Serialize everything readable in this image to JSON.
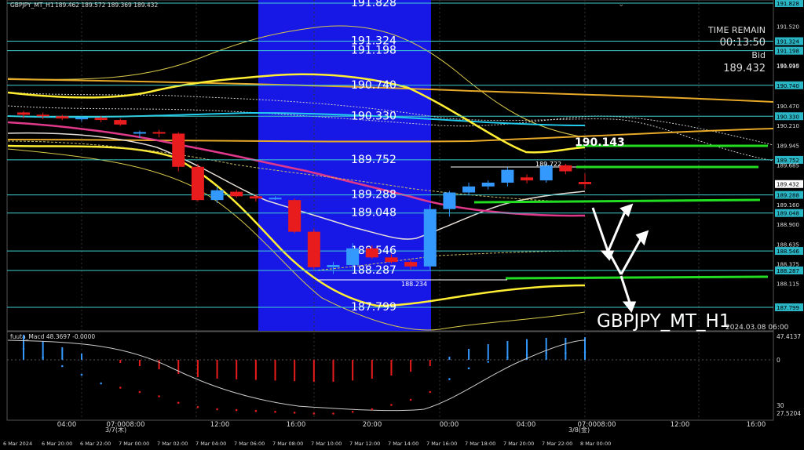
{
  "window": {
    "title": "GBPJPY_MT_H1",
    "ohlc": "189.462 189.572 189.369 189.432"
  },
  "info": {
    "time_remain_label": "TIME REMAIN",
    "time_remain": "00:13:50",
    "bid_label": "Bid",
    "bid": "189.432"
  },
  "levels": [
    {
      "label": "191.828",
      "price": 191.828
    },
    {
      "label": "191.324",
      "price": 191.324
    },
    {
      "label": "191.198",
      "price": 191.198
    },
    {
      "label": "190.740",
      "price": 190.74
    },
    {
      "label": "190.330",
      "price": 190.33
    },
    {
      "label": "189.752",
      "price": 189.752
    },
    {
      "label": "189.288",
      "price": 189.288
    },
    {
      "label": "189.048",
      "price": 189.048
    },
    {
      "label": "188.546",
      "price": 188.546
    },
    {
      "label": "188.287",
      "price": 188.287
    },
    {
      "label": "187.799",
      "price": 187.799
    }
  ],
  "annotations": {
    "target_label": "190.143",
    "high_label": "189.722",
    "low_label": "188.234",
    "watermark": "GBPJPY_MT_H1",
    "timestamp": "2024.03.08 06:00"
  },
  "price_axis": {
    "ticks": [
      "191.828",
      "191.520",
      "191.324",
      "191.198",
      "191.010",
      "190.995",
      "190.740",
      "190.470",
      "190.330",
      "190.210",
      "189.945",
      "189.752",
      "189.685",
      "189.432",
      "189.288",
      "189.160",
      "189.048",
      "188.900",
      "188.635",
      "188.546",
      "188.375",
      "188.287",
      "188.115",
      "187.799"
    ],
    "current": "189.432",
    "highlighted": [
      "191.828",
      "191.324",
      "191.198",
      "190.740",
      "190.330",
      "189.752",
      "189.288",
      "189.048",
      "188.546",
      "188.287",
      "187.799"
    ]
  },
  "macd": {
    "label": "fuuta_Macd 48.3697 -0.0000",
    "ticks": [
      "47.4137",
      "0",
      "30",
      "27.5204"
    ]
  },
  "time_axis_lower": [
    "6 Mar 2024",
    "6 Mar 20:00",
    "6 Mar 22:00",
    "7 Mar 00:00",
    "7 Mar 02:00",
    "7 Mar 04:00",
    "7 Mar 06:00",
    "7 Mar 08:00",
    "7 Mar 10:00",
    "7 Mar 12:00",
    "7 Mar 14:00",
    "7 Mar 16:00",
    "7 Mar 18:00",
    "7 Mar 20:00",
    "7 Mar 22:00",
    "8 Mar 00:00"
  ],
  "time_axis_upper": [
    "04:00",
    "07:0008:00",
    "12:00",
    "16:00",
    "20:00",
    "00:00",
    "04:00",
    "07:0008:00",
    "12:00",
    "16:00"
  ],
  "day_labels": [
    "3/7(木)",
    "3/8(金)"
  ],
  "colors": {
    "background": "#000000",
    "session_box": "#1818e6",
    "bull": "#3399ff",
    "bear": "#e81c1c",
    "level_line": "#3fd0d0",
    "green_target": "#22dd22",
    "yellow_ma": "#ffee33",
    "magenta_ma": "#e0388a",
    "cyan_ma": "#22ccee"
  }
}
